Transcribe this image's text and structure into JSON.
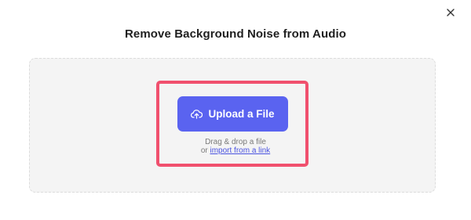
{
  "dialog": {
    "title": "Remove Background Noise from Audio",
    "close_icon": "close-icon"
  },
  "upload": {
    "button_label": "Upload a File",
    "button_icon": "cloud-upload-icon",
    "hint_line1": "Drag & drop a file",
    "hint_or": "or",
    "import_link": "import from a link"
  },
  "colors": {
    "primary": "#5a63f0",
    "highlight": "#f0506e",
    "dropzone_bg": "#f4f4f4",
    "link": "#4a53e0"
  }
}
